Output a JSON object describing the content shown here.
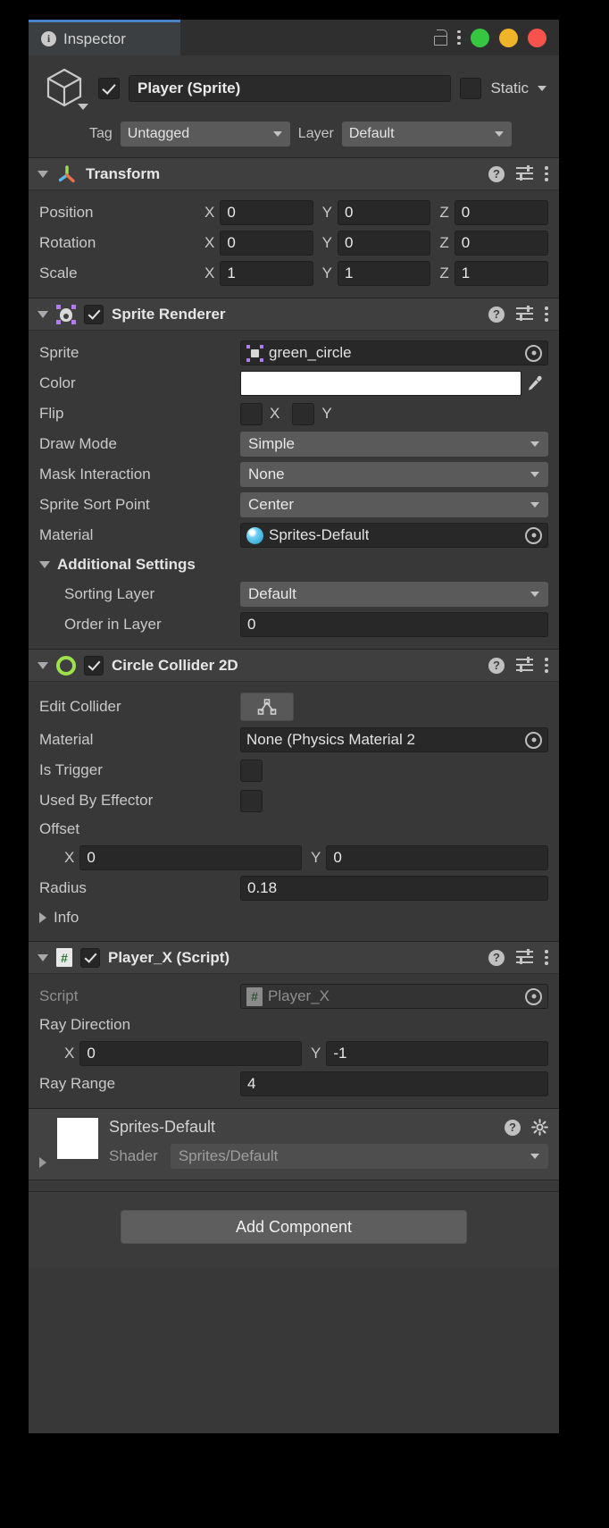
{
  "window": {
    "tab_label": "Inspector",
    "icons": {
      "info": "info-icon",
      "lock": "lock-icon",
      "menu": "kebab-menu-icon"
    },
    "traffic_lights": {
      "green": "#36c63f",
      "yellow": "#f0b429",
      "red": "#f8524c"
    },
    "accent": "#4a82c8"
  },
  "object": {
    "enabled": true,
    "name": "Player (Sprite)",
    "static_label": "Static",
    "static_checked": false,
    "tag_label": "Tag",
    "tag_value": "Untagged",
    "layer_label": "Layer",
    "layer_value": "Default"
  },
  "components": [
    {
      "title": "Transform",
      "icon": "transform-axis-icon",
      "has_toggle": false,
      "expanded": true,
      "rows": [
        {
          "label": "Position",
          "type": "vector3",
          "x": "0",
          "y": "0",
          "z": "0"
        },
        {
          "label": "Rotation",
          "type": "vector3",
          "x": "0",
          "y": "0",
          "z": "0"
        },
        {
          "label": "Scale",
          "type": "vector3",
          "x": "1",
          "y": "1",
          "z": "1"
        }
      ]
    },
    {
      "title": "Sprite Renderer",
      "icon": "sprite-renderer-icon",
      "has_toggle": true,
      "enabled": true,
      "expanded": true,
      "rows": [
        {
          "label": "Sprite",
          "type": "object",
          "value": "green_circle",
          "glyph": "sprite-asset-icon"
        },
        {
          "label": "Color",
          "type": "color",
          "value": "#ffffff"
        },
        {
          "label": "Flip",
          "type": "flip",
          "x_label": "X",
          "y_label": "Y",
          "x": false,
          "y": false
        },
        {
          "label": "Draw Mode",
          "type": "dropdown",
          "value": "Simple"
        },
        {
          "label": "Mask Interaction",
          "type": "dropdown",
          "value": "None"
        },
        {
          "label": "Sprite Sort Point",
          "type": "dropdown",
          "value": "Center"
        },
        {
          "label": "Material",
          "type": "object",
          "value": "Sprites-Default",
          "glyph": "material-ball-icon"
        },
        {
          "label": "Additional Settings",
          "type": "subfold",
          "expanded": true
        },
        {
          "label": "Sorting Layer",
          "type": "dropdown",
          "value": "Default",
          "indent": true
        },
        {
          "label": "Order in Layer",
          "type": "number",
          "value": "0",
          "indent": true
        }
      ]
    },
    {
      "title": "Circle Collider 2D",
      "icon": "circle-collider-icon",
      "has_toggle": true,
      "enabled": true,
      "expanded": true,
      "rows": [
        {
          "label": "Edit Collider",
          "type": "button",
          "glyph": "edit-collider-icon"
        },
        {
          "label": "Material",
          "type": "object",
          "value": "None (Physics Material 2"
        },
        {
          "label": "Is Trigger",
          "type": "checkbox",
          "checked": false
        },
        {
          "label": "Used By Effector",
          "type": "checkbox",
          "checked": false
        },
        {
          "label": "Offset",
          "type": "grouplabel"
        },
        {
          "label": "",
          "type": "vector2",
          "x": "0",
          "y": "0"
        },
        {
          "label": "Radius",
          "type": "number",
          "value": "0.18"
        },
        {
          "label": "Info",
          "type": "subfold",
          "expanded": false
        }
      ]
    },
    {
      "title": "Player_X (Script)",
      "icon": "csharp-script-icon",
      "has_toggle": true,
      "enabled": true,
      "expanded": true,
      "rows": [
        {
          "label": "Script",
          "type": "object",
          "value": "Player_X",
          "glyph": "csharp-script-icon",
          "disabled": true
        },
        {
          "label": "Ray Direction",
          "type": "grouplabel"
        },
        {
          "label": "",
          "type": "vector2",
          "x": "0",
          "y": "-1"
        },
        {
          "label": "Ray Range",
          "type": "number",
          "value": "4"
        }
      ]
    }
  ],
  "material_preview": {
    "name": "Sprites-Default",
    "shader_label": "Shader",
    "shader_value": "Sprites/Default",
    "swatch_color": "#ffffff",
    "icons": {
      "help": "help-icon",
      "settings": "gear-icon",
      "expand": "expand-arrow-icon"
    }
  },
  "footer": {
    "add_component_label": "Add Component"
  },
  "axis_labels": {
    "x": "X",
    "y": "Y",
    "z": "Z"
  }
}
